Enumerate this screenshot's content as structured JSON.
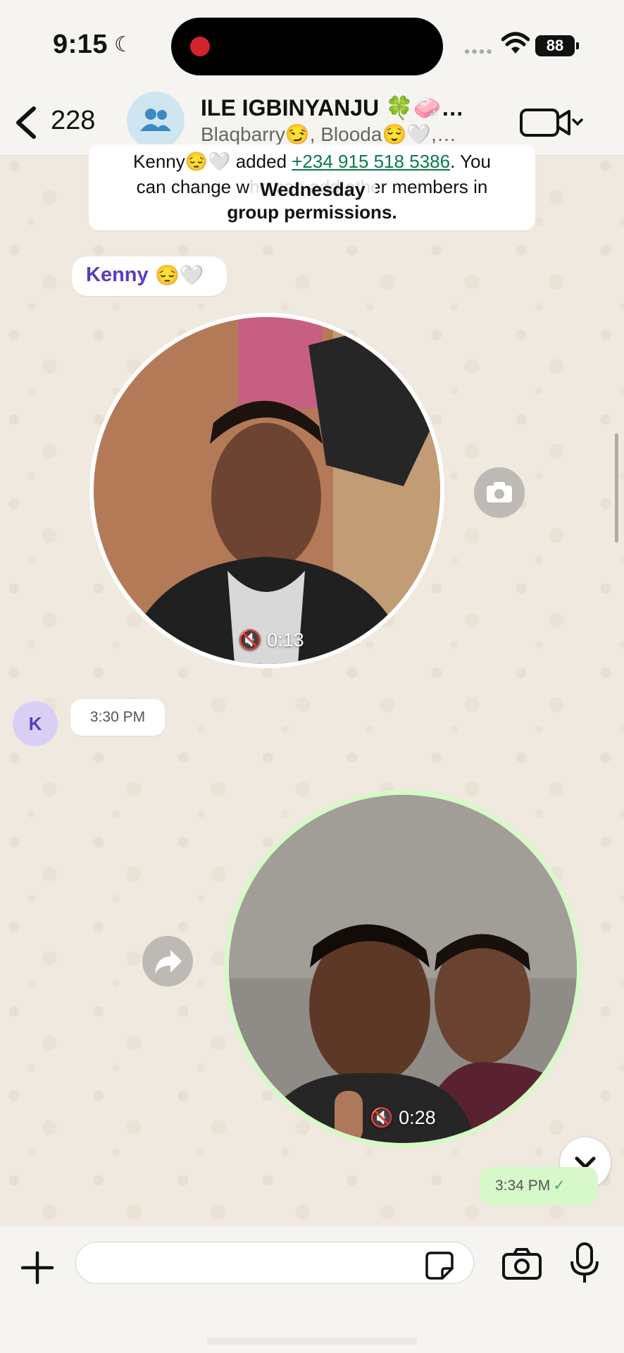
{
  "status_bar": {
    "time": "9:15",
    "battery": "88"
  },
  "header": {
    "back_count": "228",
    "group_name": "ILE IGBINYANJU 🍀🧼…",
    "members": "Blaqbarry😏, Blooda😌🤍,…"
  },
  "chat": {
    "system_message": {
      "line1_prefix": "Kenny😔🤍 added ",
      "phone": "+234 915 518 5386",
      "line1_suffix": ". You",
      "line2": "can change who can add other members in",
      "line3": "group permissions."
    },
    "date_chip": "Wednesday",
    "sender": {
      "name": "Kenny",
      "emoji": "😔🤍",
      "avatar_initial": "K"
    },
    "incoming_video": {
      "duration": "0:13",
      "time": "3:30 PM"
    },
    "outgoing_video": {
      "duration": "0:28",
      "time": "3:34 PM",
      "status_icon": "check-icon"
    }
  },
  "composer": {
    "placeholder": ""
  },
  "colors": {
    "sender_name": "#5a3cc0",
    "link": "#0b7a4b",
    "outgoing_bubble": "#d7f8c9",
    "wallpaper": "#efe9df"
  }
}
